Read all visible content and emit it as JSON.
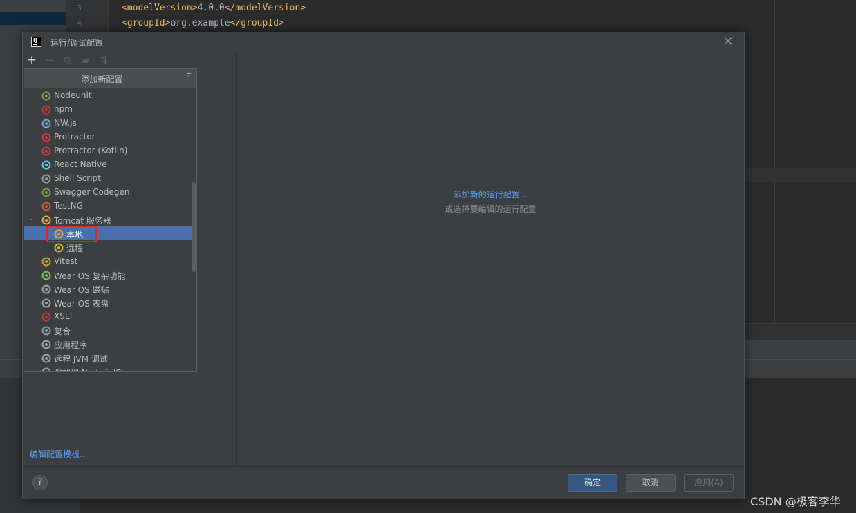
{
  "editor": {
    "line_numbers": [
      "3",
      "4"
    ],
    "lines": [
      {
        "open_tag": "<modelVersion>",
        "text": "4.0.0",
        "close_tag": "</modelVersion>"
      },
      {
        "open_tag": "<groupId>",
        "text": "org.example",
        "close_tag": "</groupId>"
      }
    ]
  },
  "dialog": {
    "app_icon_text": "IJ",
    "title": "运行/调试配置",
    "close_glyph": "×",
    "toolbar": [
      {
        "name": "add-icon",
        "glyph": "+",
        "active": true
      },
      {
        "name": "remove-icon",
        "glyph": "−",
        "active": false
      },
      {
        "name": "copy-icon",
        "glyph": "⧉",
        "active": false
      },
      {
        "name": "folder-icon",
        "glyph": "▰",
        "active": false
      },
      {
        "name": "sort-icon",
        "glyph": "⇅",
        "active": false
      }
    ],
    "popup": {
      "title": "添加新配置",
      "collapse_glyph": "≑",
      "items": [
        {
          "label": "Nodeunit",
          "icon": "nodeunit-icon",
          "color": "#7fa24a"
        },
        {
          "label": "npm",
          "icon": "npm-icon",
          "color": "#c83737"
        },
        {
          "label": "NW.js",
          "icon": "nwjs-icon",
          "color": "#7a9fc6"
        },
        {
          "label": "Protractor",
          "icon": "protractor-icon",
          "color": "#d23a3a"
        },
        {
          "label": "Protractor (Kotlin)",
          "icon": "protractor-kotlin-icon",
          "color": "#d23a3a"
        },
        {
          "label": "React Native",
          "icon": "react-native-icon",
          "color": "#5ec8e6"
        },
        {
          "label": "Shell Script",
          "icon": "shell-script-icon",
          "color": "#9a9a9a"
        },
        {
          "label": "Swagger Codegen",
          "icon": "swagger-codegen-icon",
          "color": "#6f9f3a"
        },
        {
          "label": "TestNG",
          "icon": "testng-icon",
          "color": "#d25a2a"
        },
        {
          "label": "Tomcat 服务器",
          "icon": "tomcat-icon",
          "color": "#e0b030",
          "expanded": true
        },
        {
          "label": "本地",
          "icon": "tomcat-local-icon",
          "color": "#e0b030",
          "child": true,
          "selected": true
        },
        {
          "label": "远程",
          "icon": "tomcat-remote-icon",
          "color": "#e0b030",
          "child": true
        },
        {
          "label": "Vitest",
          "icon": "vitest-icon",
          "color": "#c9a227"
        },
        {
          "label": "Wear OS 复杂功能",
          "icon": "wear-os-complication-icon",
          "color": "#7cbf5a"
        },
        {
          "label": "Wear OS 磁贴",
          "icon": "wear-os-tile-icon",
          "color": "#9aa4ad"
        },
        {
          "label": "Wear OS 表盘",
          "icon": "wear-os-watchface-icon",
          "color": "#9aa4ad"
        },
        {
          "label": "XSLT",
          "icon": "xslt-icon",
          "color": "#c83737"
        },
        {
          "label": "复合",
          "icon": "compound-icon",
          "color": "#8f9ba6"
        },
        {
          "label": "应用程序",
          "icon": "application-icon",
          "color": "#9aa4ad"
        },
        {
          "label": "远程 JVM 调试",
          "icon": "remote-jvm-debug-icon",
          "color": "#9aa4ad"
        },
        {
          "label": "附加到 Node.js/Chrome",
          "icon": "attach-node-icon",
          "color": "#9aa4ad"
        }
      ]
    },
    "edit_templates_link": "编辑配置模板...",
    "empty_state": {
      "link": "添加新的运行配置...",
      "hint": "或选择要编辑的运行配置"
    },
    "help_glyph": "?",
    "buttons": {
      "ok": "确定",
      "cancel": "取消",
      "apply": "应用(A)"
    }
  },
  "watermark": "CSDN @极客李华"
}
